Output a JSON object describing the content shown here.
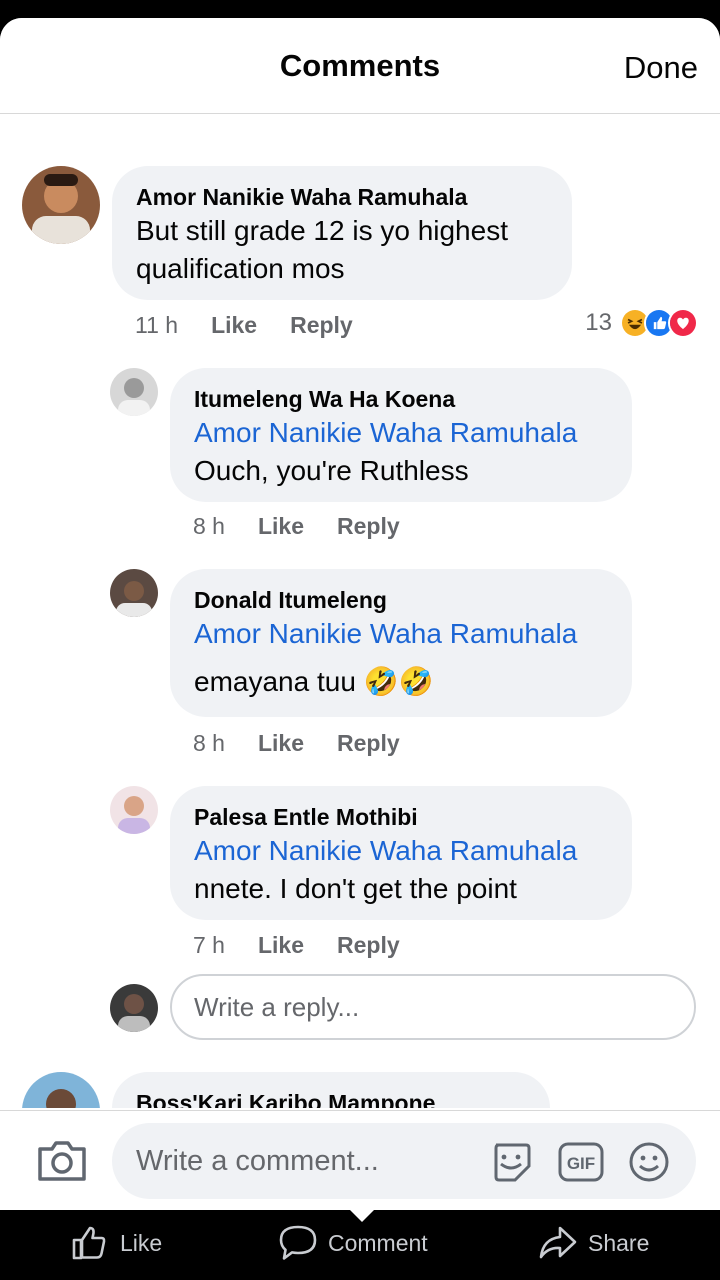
{
  "header": {
    "title": "Comments",
    "done_label": "Done"
  },
  "comments": [
    {
      "name": "Amor Nanikie Waha Ramuhala",
      "text_lines": [
        "But still grade 12 is yo highest",
        "qualification mos"
      ],
      "time": "11 h",
      "like": "Like",
      "reply": "Reply",
      "reactions": {
        "count": "13",
        "types": [
          "haha-icon",
          "like-icon",
          "love-icon"
        ]
      }
    },
    {
      "name": "Itumeleng Wa Ha Koena",
      "tag": "Amor Nanikie Waha Ramuhala",
      "text": "Ouch, you're Ruthless",
      "time": "8 h",
      "like": "Like",
      "reply": "Reply"
    },
    {
      "name": "Donald Itumeleng",
      "tag": "Amor Nanikie Waha Ramuhala",
      "text": "emayana tuu",
      "emoji": "🤣🤣",
      "time": "8 h",
      "like": "Like",
      "reply": "Reply"
    },
    {
      "name": "Palesa Entle Mothibi",
      "tag": "Amor Nanikie Waha Ramuhala",
      "text": "nnete. I don't get the point",
      "time": "7 h",
      "like": "Like",
      "reply": "Reply"
    },
    {
      "name": "Boss'Kari Karibo Mampone"
    }
  ],
  "reply_box": {
    "placeholder": "Write a reply..."
  },
  "composer": {
    "placeholder": "Write a comment...",
    "icons": [
      "camera-icon",
      "sticker-icon",
      "gif-icon",
      "emoji-icon"
    ],
    "gif_label": "GIF"
  },
  "bottom_bar": {
    "like": "Like",
    "comment": "Comment",
    "share": "Share"
  },
  "colors": {
    "mention": "#1b65d4",
    "bubble": "#f0f2f5",
    "love": "#f02849",
    "like": "#1877f2",
    "haha": "#f7b125"
  }
}
